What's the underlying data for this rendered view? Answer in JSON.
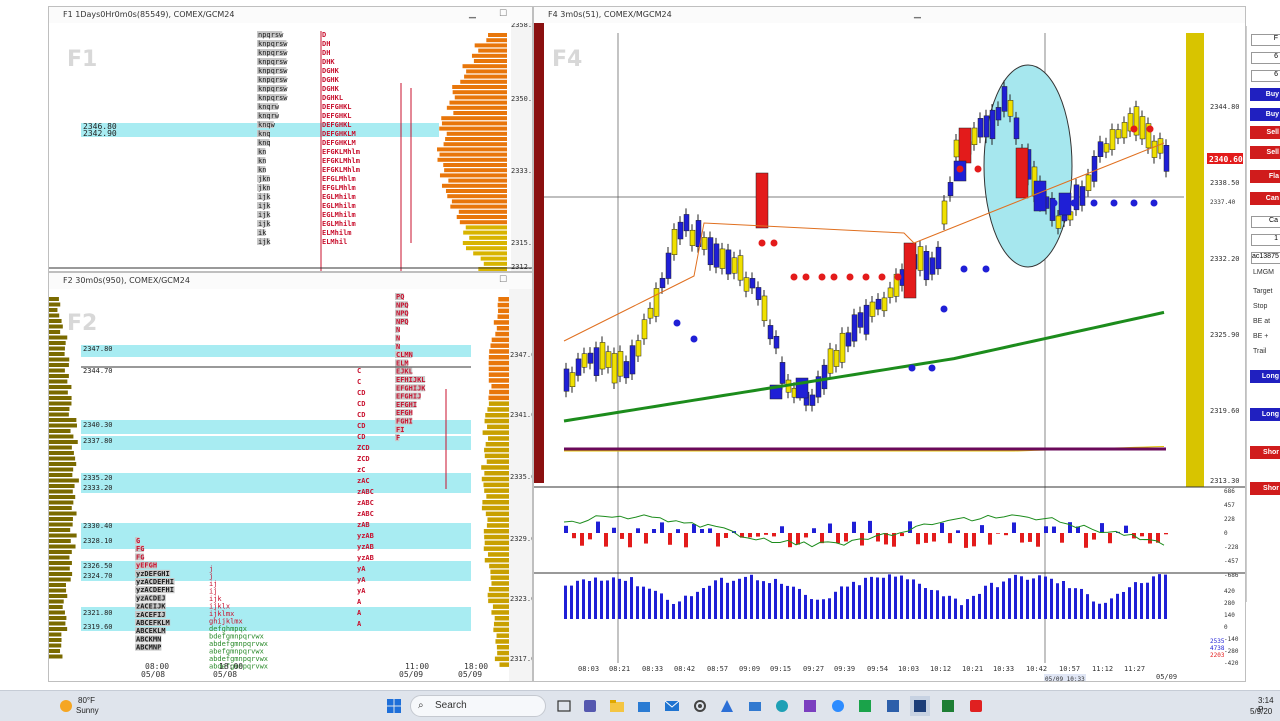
{
  "windows": {
    "f1": {
      "title": "F1 1Days0Hr0m0s(85549), COMEX/GCM24",
      "watermark": "F1",
      "prices": [
        "2358.0",
        "2350.0",
        "2333.1",
        "2315.5",
        "2312.5"
      ],
      "highlight": [
        "2346.80",
        "2342.90"
      ],
      "tpo_left": [
        "npqrsw",
        "knpqrsw",
        "knpqrsw",
        "knpqrsw",
        "knpqrsw",
        "knpqrsw",
        "knpqrsw",
        "knpqrsw",
        "knqrw",
        "knqrw",
        "knqw",
        "knq",
        "knq",
        "kn",
        "kn",
        "kn",
        "jkn",
        "jkn",
        "ijk",
        "ijk",
        "ijk",
        "ijk",
        "ik",
        "ijk"
      ],
      "tpo_mid": [
        "D",
        "DH",
        "DH",
        "DHK",
        "DGHK",
        "DGHK",
        "DGHK",
        "DGHKL",
        "DEFGHKL",
        "DEFGHKL",
        "DEFGHKL",
        "DEFGHKLM",
        "DEFGHKLM",
        "EFGKLMhlm",
        "EFGKLMhlm",
        "EFGKLMhlm",
        "EFGLMhlm",
        "EFGLMhlm",
        "EGLMhilm",
        "EGLMhilm",
        "EGLMhilm",
        "EGLMhilm",
        "ELMhilm",
        "ELMhil"
      ]
    },
    "f2": {
      "title": "F2 30m0s(950), COMEX/GCM24",
      "watermark": "F2",
      "levels": [
        "2347.80",
        "2344.70",
        "2340.30",
        "2337.80",
        "2335.20",
        "2333.20",
        "2330.40",
        "2328.10",
        "2326.50",
        "2324.70",
        "2321.80",
        "2319.60"
      ],
      "prices": [
        "2347.0",
        "2341.0",
        "2335.0",
        "2329.0",
        "2323.0",
        "2317.0"
      ],
      "times": [
        "08:00",
        "18:00",
        "11:00",
        "18:00"
      ],
      "dates": [
        "05/08",
        "05/08",
        "05/09",
        "05/09"
      ],
      "tpo_right": [
        "PQ",
        "NPQ",
        "NPQ",
        "NPQ",
        "N",
        "N",
        "N",
        "CLMN",
        "ELM",
        "EJKL",
        "EFHIJKL",
        "EFGHIJK",
        "EFGHIJ",
        "EFGHI",
        "EFGH",
        "FGHI",
        "FI",
        "F"
      ],
      "tpo_left": [
        "G",
        "FG",
        "FG",
        "yEFGH",
        "yzDEFGHI",
        "yzACDEFHI",
        "yzACDEFHI",
        "yzACDEJ",
        "zACEIJK",
        "zACEFIJ",
        "ABCEFKLM",
        "ABCEKLM",
        "ABCKMN",
        "ABCMNP"
      ],
      "tpo_m1": [
        "j",
        "j",
        "ij",
        "ij",
        "ijk",
        "ijklx",
        "ijklmx",
        "ghijklmx",
        "defghmpqx",
        "bdefgmnpqrvwx",
        "abdefgmnpqrvwx",
        "abefgmnpqrvwx",
        "abdefgmnpqrvwx",
        "abdefgmnpqrvwx"
      ],
      "tpo_m2": [
        "C",
        "C",
        "CD",
        "CD",
        "CD",
        "CD",
        "CD",
        "ZCD",
        "ZCD",
        "zC",
        "zAC",
        "zABC",
        "zABC",
        "zABC",
        "zAB",
        "yzAB",
        "yzAB",
        "yzAB",
        "yA",
        "yA",
        "yA",
        "A",
        "A",
        "A"
      ]
    },
    "f4": {
      "title": "F4 3m0s(51), COMEX/MGCM24",
      "watermark": "F4",
      "prices": [
        "2344.80",
        "2338.50",
        "2332.20",
        "2325.90",
        "2319.60",
        "2313.30"
      ],
      "current_price": "2340.60",
      "small_price": "2337.40",
      "times": [
        "08:03",
        "08:21",
        "08:33",
        "08:42",
        "08:57",
        "09:09",
        "09:15",
        "09:27",
        "09:39",
        "09:54",
        "10:03",
        "10:12",
        "10:21",
        "10:33",
        "10:42",
        "10:57",
        "11:12",
        "11:27"
      ],
      "cursor_label": "05/09 10:33",
      "last_date": "05/09",
      "osc1_ticks": [
        "686",
        "457",
        "228",
        "0",
        "-228",
        "-457",
        "-686"
      ],
      "osc2_ticks": [
        "420",
        "280",
        "140",
        "0",
        "-140",
        "-280",
        "-420"
      ],
      "osc2_values": [
        "2535",
        "4738",
        "2203"
      ]
    }
  },
  "right_panel": {
    "buttons": [
      {
        "label": "Buy",
        "color": "#2020c0"
      },
      {
        "label": "Buy",
        "color": "#2020c0"
      },
      {
        "label": "Sell",
        "color": "#d01c1c"
      },
      {
        "label": "Sell",
        "color": "#d01c1c"
      },
      {
        "label": "Fla",
        "color": "#d01c1c"
      },
      {
        "label": "Can",
        "color": "#d01c1c"
      }
    ],
    "fields": [
      "F",
      "6",
      "6",
      "Ca",
      "1",
      "ac13875"
    ],
    "account_label": "LMGM",
    "labels": [
      "Target",
      "Stop",
      "BE at",
      "BE +",
      "Trail"
    ],
    "lower_buttons": [
      {
        "label": "Long",
        "color": "#2020c0"
      },
      {
        "label": "Long",
        "color": "#2020c0"
      },
      {
        "label": "Shor",
        "color": "#d01c1c"
      },
      {
        "label": "Shor",
        "color": "#d01c1c"
      }
    ]
  },
  "taskbar": {
    "weather_temp": "80°F",
    "weather_desc": "Sunny",
    "search_placeholder": "Search",
    "time": "3:14 P",
    "date": "5/9/20"
  },
  "colors": {
    "tpo_red": "#c8102e",
    "profile_orange": "#e8760a",
    "highlight": "#a8ecf2",
    "buy_blue": "#2020c0",
    "sell_red": "#d01c1c",
    "ma_green": "#1c8c1c",
    "session_purple": "#6a0a5a"
  }
}
